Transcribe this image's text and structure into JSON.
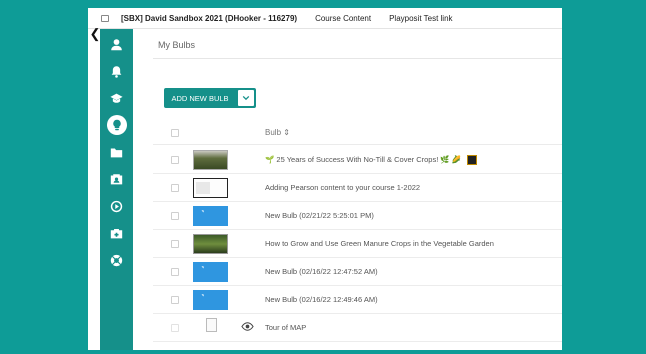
{
  "topbar": {
    "course_title": "[SBX] David Sandbox 2021 (DHooker - 116279)",
    "tabs": [
      "Course Content",
      "Playposit Test link"
    ]
  },
  "sidenav": {
    "items": [
      {
        "icon": "user-icon"
      },
      {
        "icon": "bell-icon"
      },
      {
        "icon": "graduation-cap-icon"
      },
      {
        "icon": "lightbulb-icon",
        "active": true
      },
      {
        "icon": "folder-icon"
      },
      {
        "icon": "id-card-icon"
      },
      {
        "icon": "play-circle-icon"
      },
      {
        "icon": "briefcase-icon"
      },
      {
        "icon": "help-lifebuoy-icon"
      }
    ]
  },
  "page": {
    "title": "My Bulbs",
    "add_button_label": "ADD NEW BULB",
    "column_header": "Bulb ⇕"
  },
  "rows": [
    {
      "title": "🌱 25 Years of Success With No-Till & Cover Crops! 🌿 🌽",
      "thumb": "video"
    },
    {
      "title": "Adding Pearson content to your course 1-2022",
      "thumb": "doc"
    },
    {
      "title": "New Bulb (02/21/22 5:25:01 PM)",
      "thumb": "bulb"
    },
    {
      "title": "How to Grow and Use Green Manure Crops in the Vegetable Garden",
      "thumb": "garden"
    },
    {
      "title": "New Bulb (02/16/22 12:47:52 AM)",
      "thumb": "bulb"
    },
    {
      "title": "New Bulb (02/16/22 12:49:46 AM)",
      "thumb": "bulb"
    },
    {
      "title": "Tour of MAP",
      "thumb": "broken"
    }
  ],
  "colors": {
    "teal": "#0e9c97",
    "sidebar": "#15908a",
    "bulb_blue": "#2f96e0"
  }
}
